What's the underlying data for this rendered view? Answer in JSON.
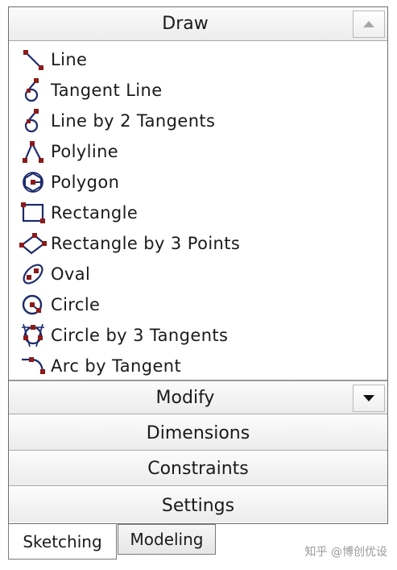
{
  "panel": {
    "draw_section": {
      "label": "Draw"
    },
    "tools": [
      {
        "label": "Line",
        "icon": "line-icon"
      },
      {
        "label": "Tangent Line",
        "icon": "tangent-line-icon"
      },
      {
        "label": "Line by 2 Tangents",
        "icon": "line-by-2-tangents-icon"
      },
      {
        "label": "Polyline",
        "icon": "polyline-icon"
      },
      {
        "label": "Polygon",
        "icon": "polygon-icon"
      },
      {
        "label": "Rectangle",
        "icon": "rectangle-icon"
      },
      {
        "label": "Rectangle by 3 Points",
        "icon": "rectangle-by-3-points-icon"
      },
      {
        "label": "Oval",
        "icon": "oval-icon"
      },
      {
        "label": "Circle",
        "icon": "circle-icon"
      },
      {
        "label": "Circle by 3 Tangents",
        "icon": "circle-by-3-tangents-icon"
      },
      {
        "label": "Arc by Tangent",
        "icon": "arc-by-tangent-icon"
      }
    ],
    "sections": [
      {
        "label": "Modify"
      },
      {
        "label": "Dimensions"
      },
      {
        "label": "Constraints"
      },
      {
        "label": "Settings"
      }
    ]
  },
  "tabs": [
    {
      "label": "Sketching",
      "active": true
    },
    {
      "label": "Modeling",
      "active": false
    }
  ],
  "watermark": "知乎 @博创优设",
  "colors": {
    "icon_stroke": "#1c2a6b",
    "icon_point": "#8b1a1a"
  }
}
